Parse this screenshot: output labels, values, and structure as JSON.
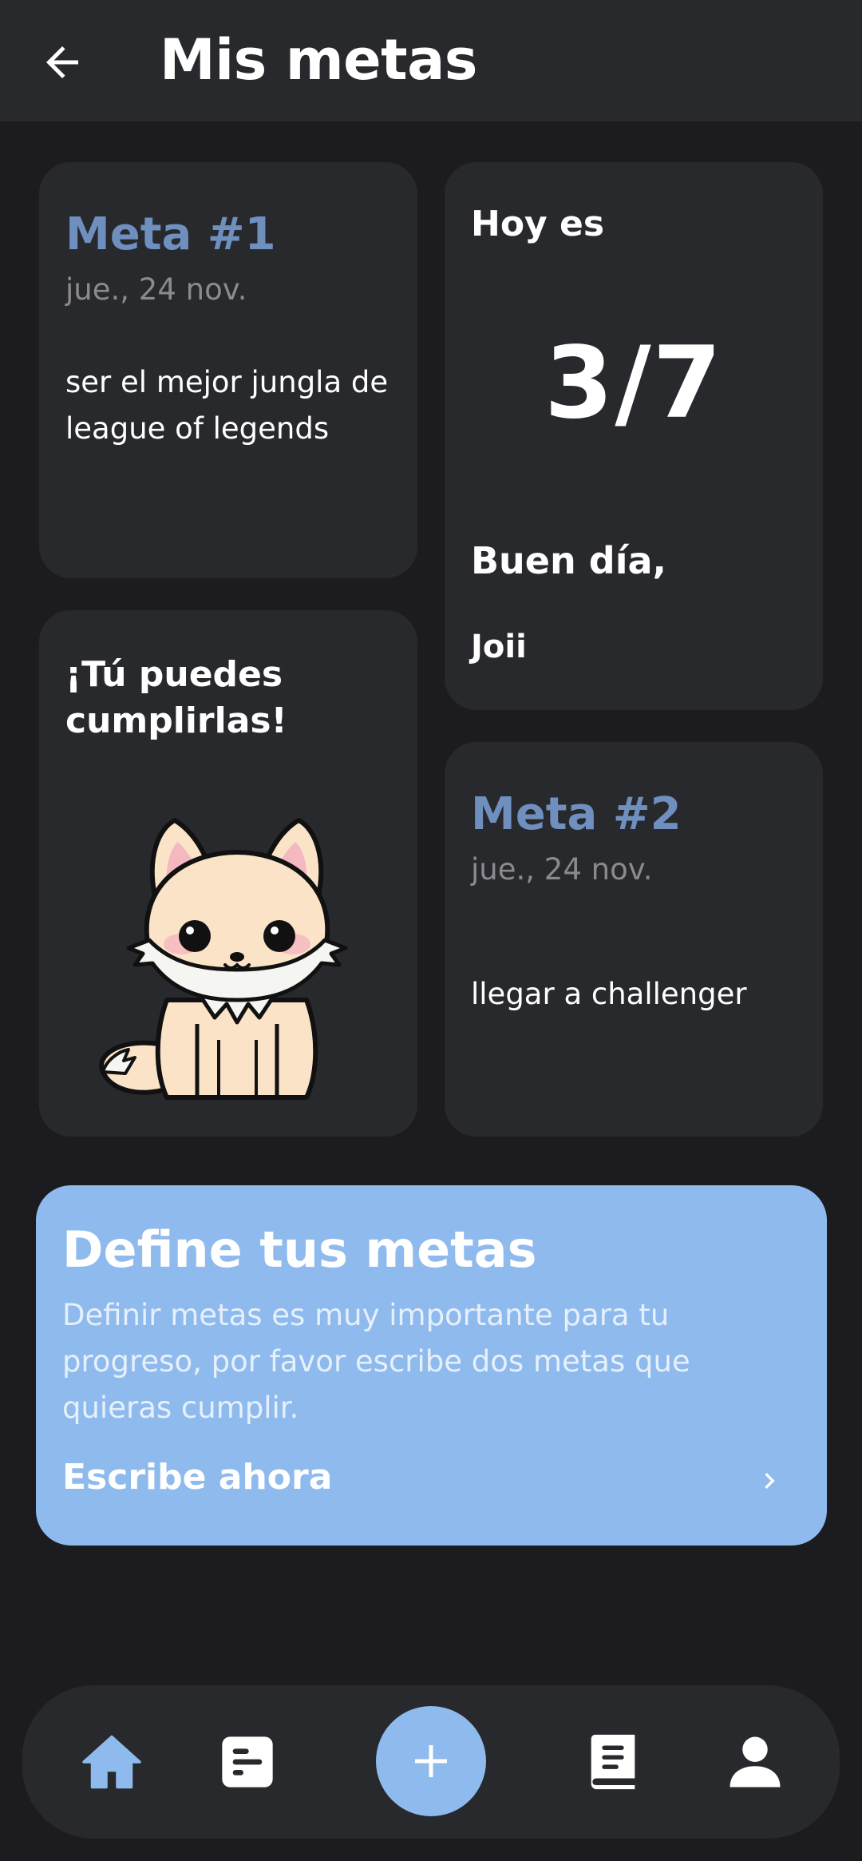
{
  "header": {
    "title": "Mis metas",
    "back_icon": "arrow-left-icon"
  },
  "goals": [
    {
      "title": "Meta #1",
      "date": "jue., 24 nov.",
      "text": "ser el mejor jungla de league of legends"
    },
    {
      "title": "Meta #2",
      "date": "jue., 24 nov.",
      "text": "llegar a challenger"
    }
  ],
  "today": {
    "label": "Hoy es",
    "count": "3/7",
    "greeting": "Buen día,",
    "username": "Joii"
  },
  "motivation": {
    "text": "¡Tú puedes cumplirlas!",
    "illustration": "fox-mascot"
  },
  "banner": {
    "title": "Define tus metas",
    "description": "Definir metas es muy importante para tu progreso,  por favor escribe dos metas que quieras cumplir.",
    "cta": "Escribe ahora"
  },
  "bottom_nav": {
    "items": [
      "home-icon",
      "notes-icon",
      "add-icon",
      "book-icon",
      "profile-icon"
    ],
    "active": "home-icon"
  },
  "colors": {
    "background": "#1c1c20",
    "card": "#28292d",
    "accent": "#8fbaed",
    "meta_title": "#6f8fbf",
    "muted": "#8a8a8f"
  }
}
